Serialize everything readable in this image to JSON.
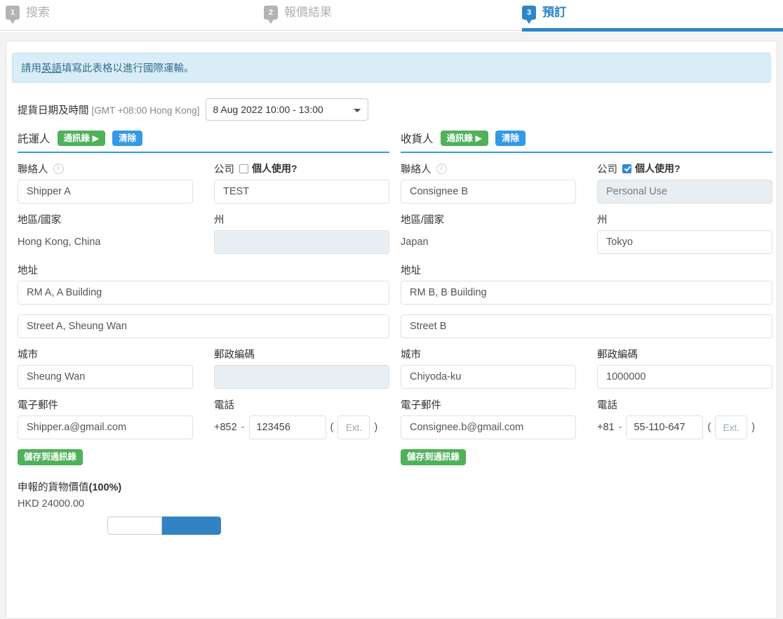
{
  "steps": [
    {
      "number": "1",
      "label": "搜索",
      "active": false
    },
    {
      "number": "2",
      "label": "報價結果",
      "active": false
    },
    {
      "number": "3",
      "label": "預訂",
      "active": true
    }
  ],
  "alert": {
    "prefix": "請用",
    "link": "英語",
    "suffix": "填寫此表格以進行國際運輸。"
  },
  "pickup": {
    "label": "提貨日期及時間",
    "timezone": "[GMT +08:00 Hong Kong]",
    "selected": "8 Aug 2022 10:00 - 13:00",
    "options": [
      "8 Aug 2022 10:00 - 13:00"
    ]
  },
  "shipper": {
    "title": "託運人",
    "address_book_button": "通訊錄 ▶",
    "clear_button": "清除",
    "contact_label": "聯絡人",
    "contact_info_icon": "info-icon",
    "contact_value": "Shipper A",
    "company_label": "公司",
    "personal_use_label": "個人使用?",
    "personal_use_checked": false,
    "company_value": "TEST",
    "region_label": "地區/國家",
    "region_value": "Hong Kong, China",
    "state_label": "州",
    "state_value": "",
    "state_disabled": true,
    "address_label": "地址",
    "address_line1": "RM A, A Building",
    "address_line2": "Street A, Sheung Wan",
    "city_label": "城市",
    "city_value": "Sheung Wan",
    "postal_label": "郵政編碼",
    "postal_value": "",
    "postal_disabled": true,
    "email_label": "電子郵件",
    "email_value": "Shipper.a@gmail.com",
    "phone_label": "電話",
    "phone_country_code": "+852",
    "phone_separator": "-",
    "phone_number": "123456",
    "phone_ext_placeholder": "Ext.",
    "phone_ext_value": "",
    "paren_open": "(",
    "paren_close": ")",
    "save_button": "儲存到通訊錄"
  },
  "consignee": {
    "title": "收貨人",
    "address_book_button": "通訊錄 ▶",
    "clear_button": "清除",
    "contact_label": "聯絡人",
    "contact_info_icon": "info-icon",
    "contact_value": "Consignee B",
    "company_label": "公司",
    "personal_use_label": "個人使用?",
    "personal_use_checked": true,
    "company_value": "Personal Use",
    "region_label": "地區/國家",
    "region_value": "Japan",
    "state_label": "州",
    "state_value": "Tokyo",
    "state_disabled": false,
    "address_label": "地址",
    "address_line1": "RM B, B Building",
    "address_line2": "Street B",
    "city_label": "城市",
    "city_value": "Chiyoda-ku",
    "postal_label": "郵政編碼",
    "postal_value": "1000000",
    "postal_disabled": false,
    "email_label": "電子郵件",
    "email_value": "Consignee.b@gmail.com",
    "phone_label": "電話",
    "phone_country_code": "+81",
    "phone_separator": "-",
    "phone_number": "55-110-647",
    "phone_ext_placeholder": "Ext.",
    "phone_ext_value": "",
    "paren_open": "(",
    "paren_close": ")",
    "save_button": "儲存到通訊錄"
  },
  "declared": {
    "title_text": "申報的貨物價值",
    "title_percent": "(100%)",
    "amount": "HKD 24000.00",
    "input_value": ""
  },
  "colors": {
    "accent_blue": "#2e86c8",
    "button_green": "#4fb15a",
    "button_blue": "#3399e8",
    "alert_bg": "#d9edf7",
    "alert_text": "#31708f",
    "disabled_bg": "#e9eef2"
  }
}
